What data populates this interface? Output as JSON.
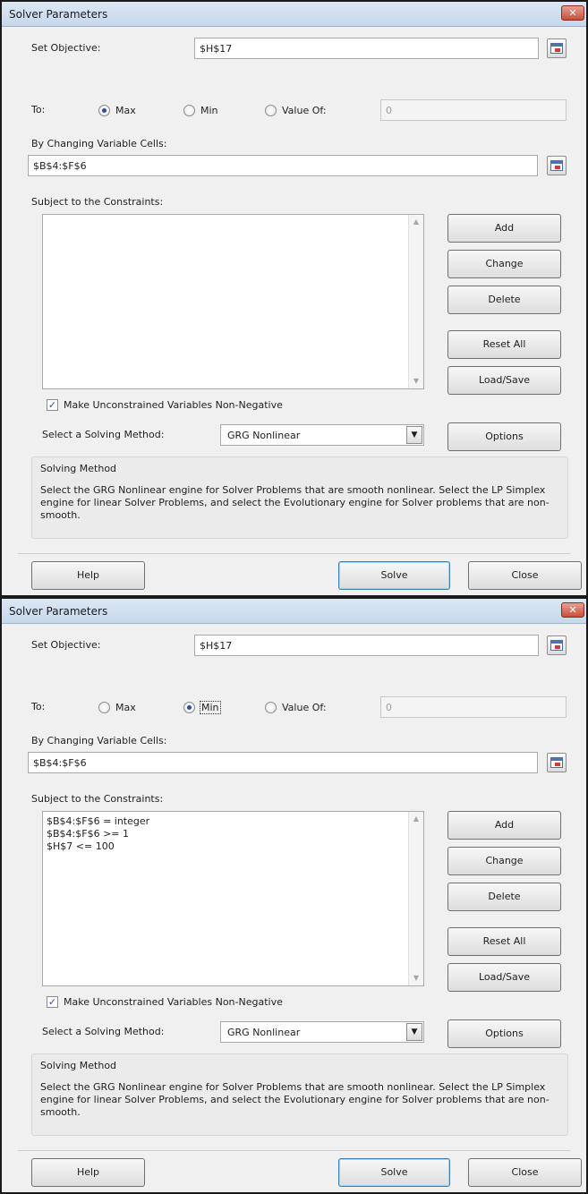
{
  "dialogs": [
    {
      "title": "Solver Parameters",
      "close_glyph": "✕",
      "set_objective_label": "Set Objective:",
      "set_objective_value": "$H$17",
      "to_label": "To:",
      "radio_max": "Max",
      "radio_min": "Min",
      "radio_value_of": "Value Of:",
      "selected": "Max",
      "value_of_input": "0",
      "changing_cells_label": "By Changing Variable Cells:",
      "changing_cells_value": "$B$4:$F$6",
      "constraints_label": "Subject to the Constraints:",
      "constraints": [],
      "add": "Add",
      "change": "Change",
      "delete": "Delete",
      "reset_all": "Reset All",
      "load_save": "Load/Save",
      "checkbox_label": "Make Unconstrained Variables Non-Negative",
      "checkbox_checked": true,
      "method_label": "Select a Solving Method:",
      "method_value": "GRG Nonlinear",
      "options": "Options",
      "solving_method_title": "Solving Method",
      "solving_method_desc": "Select the GRG Nonlinear engine for Solver Problems that are smooth nonlinear. Select the LP Simplex engine for linear Solver Problems, and select the Evolutionary engine for Solver problems that are non-smooth.",
      "help": "Help",
      "solve": "Solve",
      "close": "Close"
    },
    {
      "title": "Solver Parameters",
      "close_glyph": "✕",
      "set_objective_label": "Set Objective:",
      "set_objective_value": "$H$17",
      "to_label": "To:",
      "radio_max": "Max",
      "radio_min": "Min",
      "radio_value_of": "Value Of:",
      "selected": "Min",
      "value_of_input": "0",
      "changing_cells_label": "By Changing Variable Cells:",
      "changing_cells_value": "$B$4:$F$6",
      "constraints_label": "Subject to the Constraints:",
      "constraints": [
        "$B$4:$F$6 = integer",
        "$B$4:$F$6 >= 1",
        "$H$7 <= 100"
      ],
      "add": "Add",
      "change": "Change",
      "delete": "Delete",
      "reset_all": "Reset All",
      "load_save": "Load/Save",
      "checkbox_label": "Make Unconstrained Variables Non-Negative",
      "checkbox_checked": true,
      "method_label": "Select a Solving Method:",
      "method_value": "GRG Nonlinear",
      "options": "Options",
      "solving_method_title": "Solving Method",
      "solving_method_desc": "Select the GRG Nonlinear engine for Solver Problems that are smooth nonlinear. Select the LP Simplex engine for linear Solver Problems, and select the Evolutionary engine for Solver problems that are non-smooth.",
      "help": "Help",
      "solve": "Solve",
      "close": "Close"
    }
  ]
}
